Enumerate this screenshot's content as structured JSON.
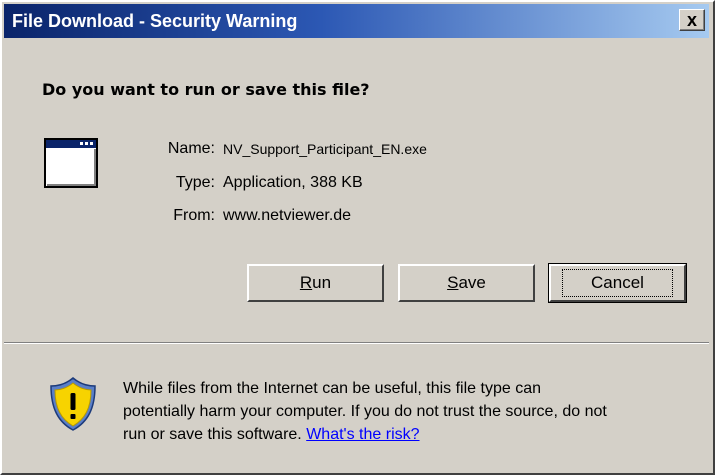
{
  "window": {
    "title": "File Download - Security Warning",
    "close_glyph": "x"
  },
  "question": "Do you want to run or save this file?",
  "file": {
    "icon": "application-window-icon",
    "name_label": "Name:",
    "name_value": "NV_Support_Participant_EN.exe",
    "type_label": "Type:",
    "type_value": "Application, 388 KB",
    "from_label": "From:",
    "from_value": "www.netviewer.de"
  },
  "buttons": {
    "run": {
      "accel": "R",
      "rest": "un"
    },
    "save": {
      "accel": "S",
      "rest": "ave"
    },
    "cancel": "Cancel"
  },
  "warning": {
    "icon": "shield-warning-icon",
    "line1": "While files from the Internet can be useful, this file type can",
    "line2": "potentially harm your computer. If you do not trust the source, do not",
    "line3": "run or save this software.",
    "link": "What's the risk?"
  },
  "colors": {
    "dialog_bg": "#d4d0c8",
    "title_start": "#0a246a",
    "title_end": "#a6caf0",
    "link": "#0000ff",
    "shield_yellow": "#f7d300",
    "shield_blue": "#5a7fc8"
  }
}
